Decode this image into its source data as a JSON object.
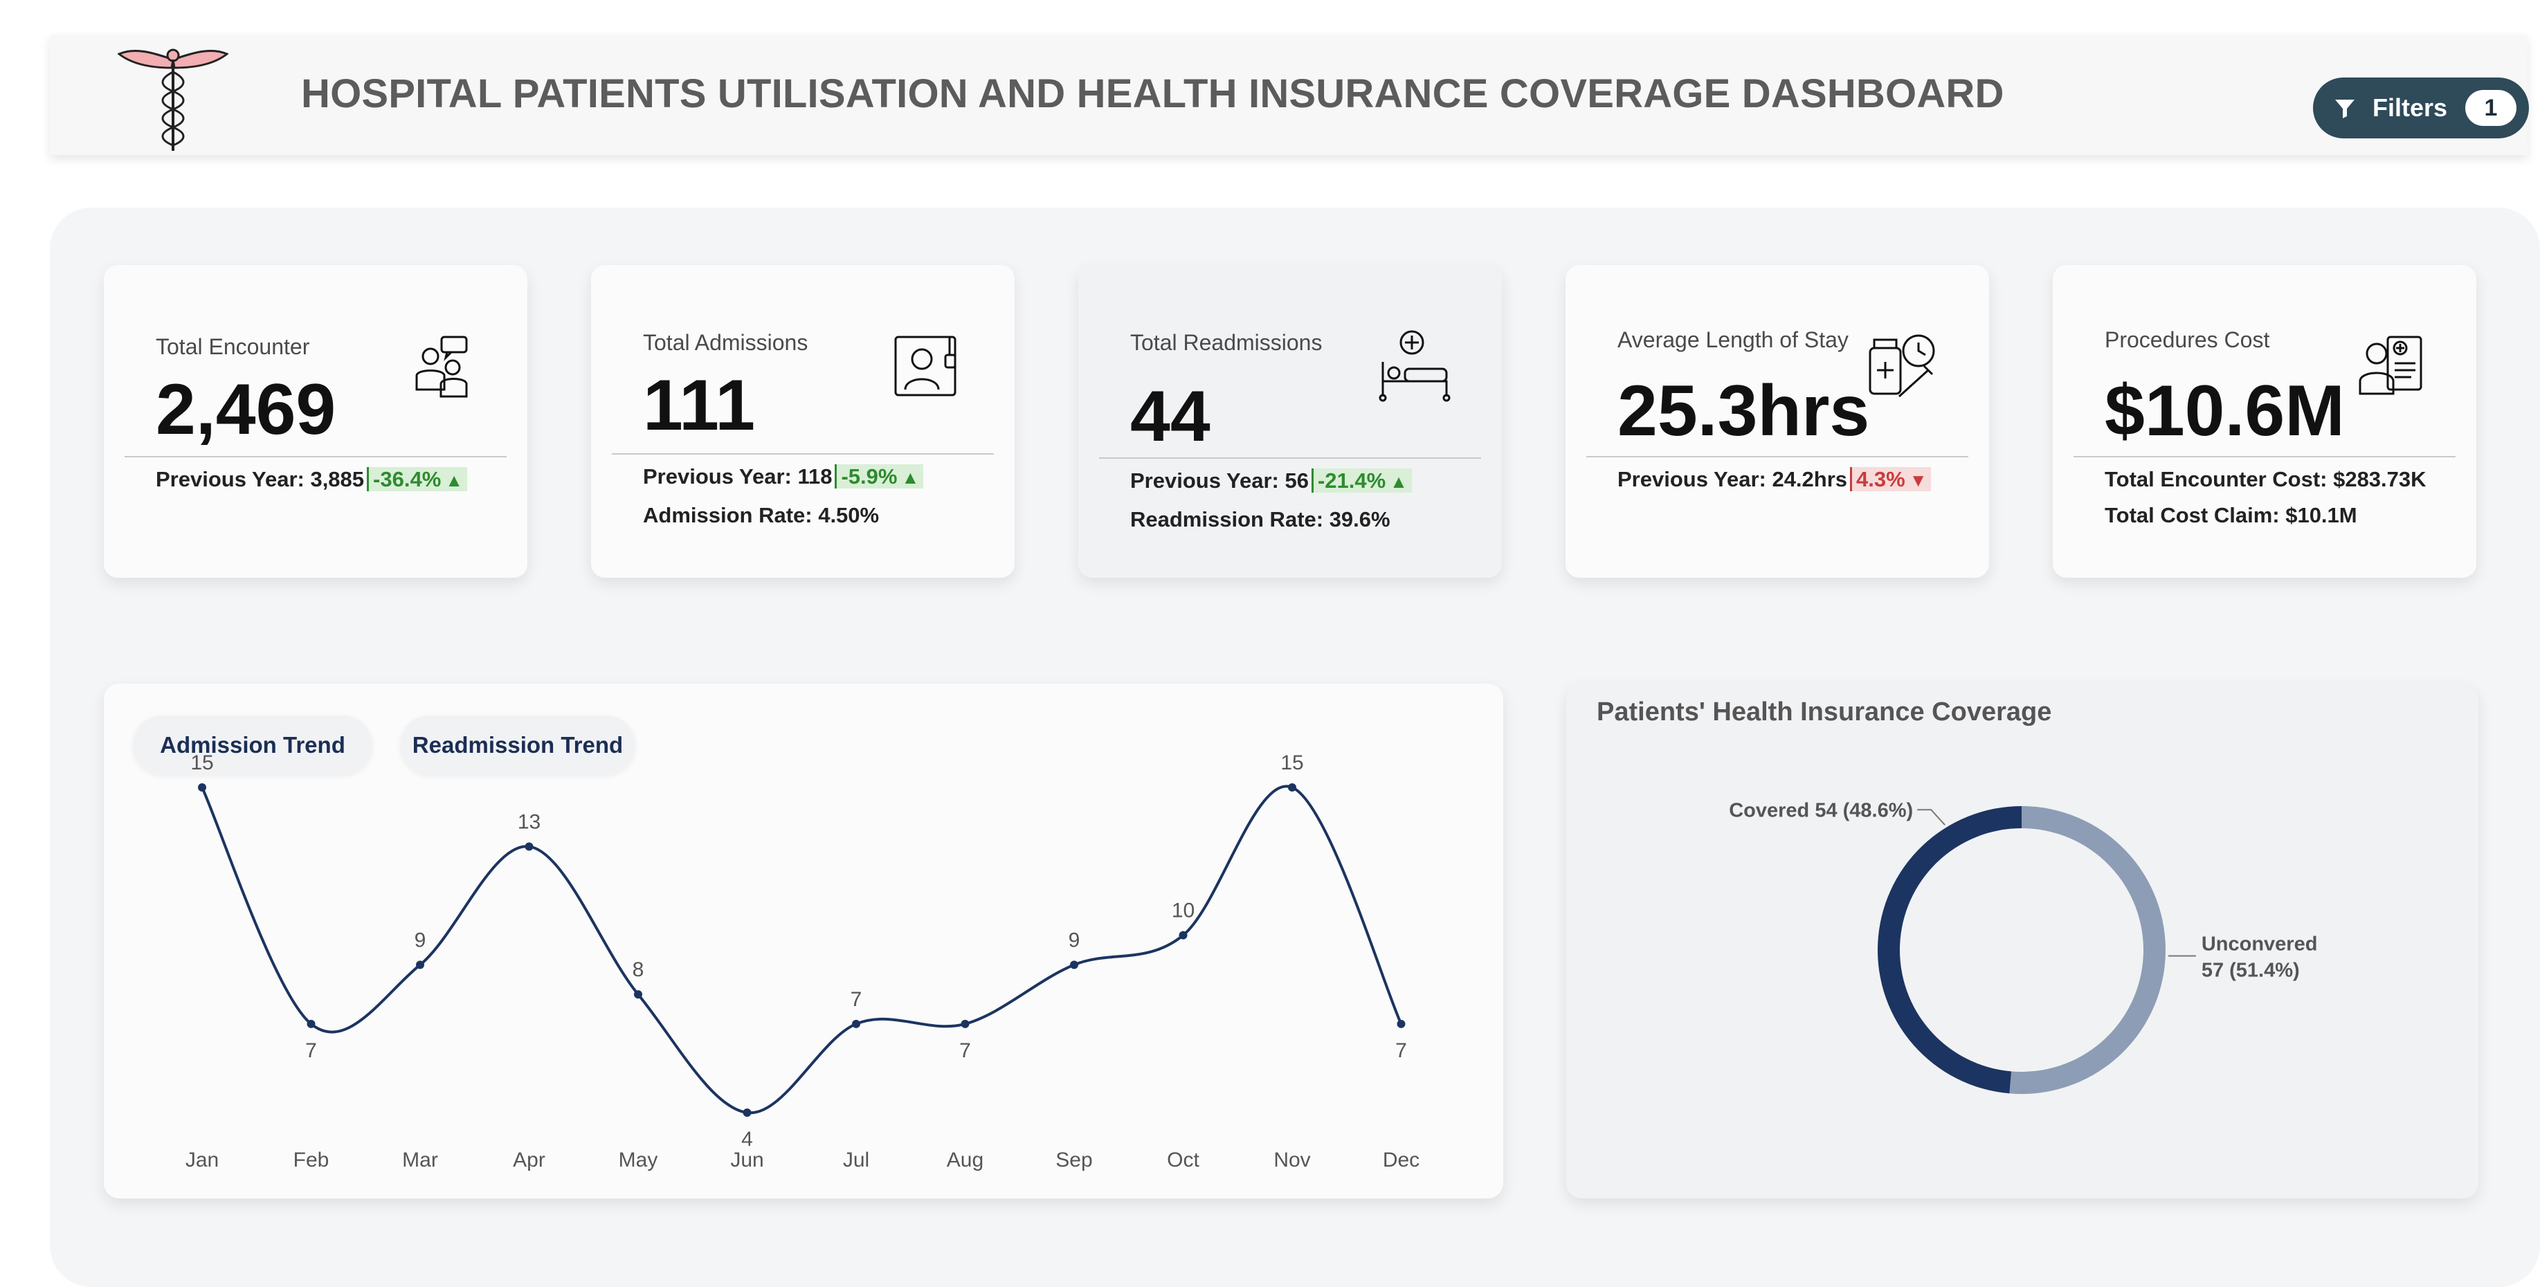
{
  "header": {
    "title": "HOSPITAL PATIENTS UTILISATION AND HEALTH INSURANCE COVERAGE DASHBOARD",
    "logo_icon": "caduceus-icon",
    "filters_label": "Filters",
    "filters_count": "1"
  },
  "kpis": [
    {
      "label": "Total Encounter",
      "value": "2,469",
      "prev": "Previous Year: 3,885",
      "change": "-36.4%",
      "direction": "up",
      "sub": "",
      "icon": "patients-icon"
    },
    {
      "label": "Total Admissions",
      "value": "111",
      "prev": "Previous Year: 118",
      "change": "-5.9%",
      "direction": "up",
      "sub": "Admission Rate: 4.50%",
      "icon": "patient-in-bed-icon"
    },
    {
      "label": "Total Readmissions",
      "value": "44",
      "prev": "Previous Year: 56",
      "change": "-21.4%",
      "direction": "up",
      "sub": "Readmission Rate: 39.6%",
      "icon": "hospital-bed-icon"
    },
    {
      "label": "Average Length of Stay",
      "value": "25.3hrs",
      "prev": "Previous Year: 24.2hrs",
      "change": "4.3%",
      "direction": "down",
      "sub": "",
      "icon": "medicine-clock-icon"
    },
    {
      "label": "Procedures Cost",
      "value": "$10.6M",
      "prev": "Total Encounter Cost: $283.73K",
      "change": "",
      "direction": "",
      "sub": "Total Cost Claim: $10.1M",
      "icon": "doctor-report-icon"
    }
  ],
  "trend_tabs": {
    "admission": "Admission Trend",
    "readmission": "Readmission Trend"
  },
  "coverage": {
    "title": "Patients' Health Insurance Coverage"
  },
  "colors": {
    "navy": "#1c3461",
    "light_slate": "#8d9db5",
    "up_green": "#2e8b2e",
    "down_red": "#c93c3c",
    "filter_bg": "#2f4a59"
  },
  "chart_data": [
    {
      "type": "line",
      "categories": [
        "Jan",
        "Feb",
        "Mar",
        "Apr",
        "May",
        "Jun",
        "Jul",
        "Aug",
        "Sep",
        "Oct",
        "Nov",
        "Dec"
      ],
      "values": [
        15,
        7,
        9,
        13,
        8,
        4,
        7,
        7,
        9,
        10,
        15,
        7
      ],
      "ylim": [
        4,
        15
      ],
      "grid": false
    },
    {
      "type": "pie",
      "style": "donut",
      "labels": [
        "Covered",
        "Unconvered"
      ],
      "values": [
        54,
        57
      ],
      "percent_labels": [
        "48.6%",
        "51.4%"
      ],
      "colors": [
        "#1c3461",
        "#8d9db5"
      ]
    }
  ]
}
